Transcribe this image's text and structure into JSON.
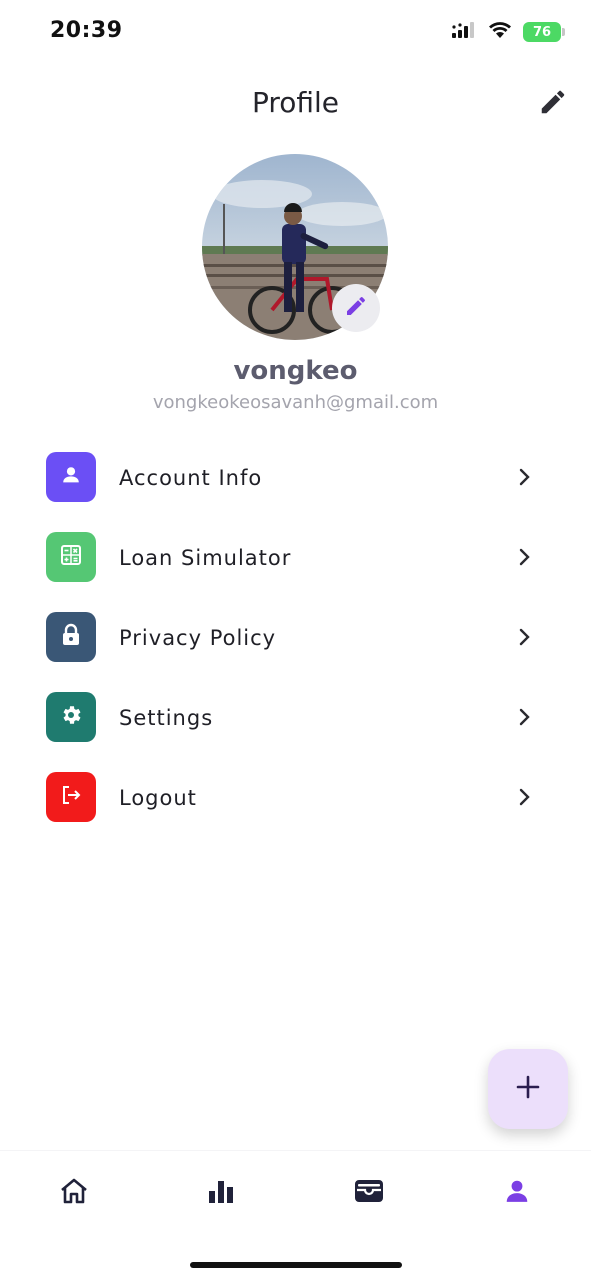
{
  "status_bar": {
    "time": "20:39",
    "battery": "76",
    "icons": [
      "cellular-signal-icon",
      "wifi-icon",
      "battery-charging-icon"
    ]
  },
  "header": {
    "title": "Profile",
    "edit_icon": "pencil-icon"
  },
  "profile": {
    "name": "vongkeo",
    "email": "vongkeokeosavanh@gmail.com",
    "avatar_edit_icon": "pencil-icon"
  },
  "menu": [
    {
      "label": "Account Info",
      "icon": "person-icon",
      "color": "#6b4ff5"
    },
    {
      "label": "Loan Simulator",
      "icon": "calculator-icon",
      "color": "#55c774"
    },
    {
      "label": "Privacy Policy",
      "icon": "lock-icon",
      "color": "#3a5776"
    },
    {
      "label": "Settings",
      "icon": "gear-icon",
      "color": "#1f7b6f"
    },
    {
      "label": "Logout",
      "icon": "logout-icon",
      "color": "#f21b1b"
    }
  ],
  "fab": {
    "icon": "plus-icon",
    "color": "#ecdffb"
  },
  "bottom_nav": [
    {
      "icon": "home-icon",
      "active": false
    },
    {
      "icon": "bar-chart-icon",
      "active": false
    },
    {
      "icon": "wallet-icon",
      "active": false
    },
    {
      "icon": "person-icon",
      "active": true
    }
  ],
  "colors": {
    "accent": "#7b3fe4",
    "text_primary": "#1f1f26",
    "text_muted": "#a4a4ad",
    "name": "#5c5c6e"
  }
}
